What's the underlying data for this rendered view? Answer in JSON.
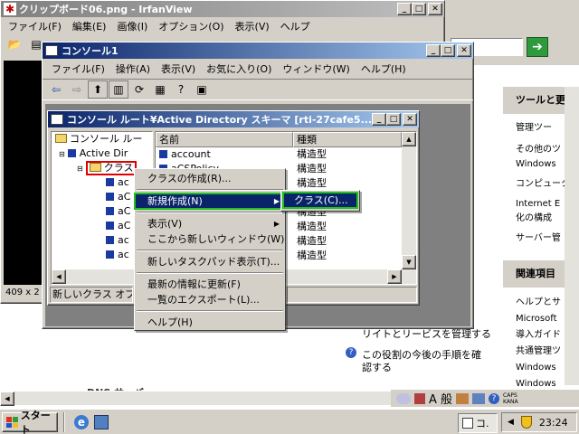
{
  "irfan": {
    "title": "クリップボード06.png - IrfanView",
    "menu": [
      "ファイル(F)",
      "編集(E)",
      "画像(I)",
      "オプション(O)",
      "表示(V)",
      "ヘルプ"
    ],
    "status": "409 x 2"
  },
  "console": {
    "title": "コンソール1",
    "menu": [
      "ファイル(F)",
      "操作(A)",
      "表示(V)",
      "お気に入り(O)",
      "ウィンドウ(W)",
      "ヘルプ(H)"
    ]
  },
  "schema": {
    "title": "コンソール ルート¥Active Directory スキーマ [rti-27cafe5...",
    "tree": {
      "root": "コンソール ルー",
      "ad": "Active Dir",
      "classes": "クラス",
      "items": [
        "ac",
        "aC",
        "aC",
        "aC",
        "ac",
        "ac"
      ]
    },
    "columns": {
      "name": "名前",
      "type": "種類"
    },
    "rows": [
      {
        "name": "account",
        "type": "構造型"
      },
      {
        "name": "aCSPolicy",
        "type": "構造型"
      },
      {
        "name": "",
        "type": "構造型"
      },
      {
        "name": "",
        "type": "構造型"
      },
      {
        "name": "",
        "type": "構造型"
      },
      {
        "name": "",
        "type": "構造型"
      },
      {
        "name": "",
        "type": "構造型"
      },
      {
        "name": "",
        "type": "構造型"
      }
    ],
    "status": "新しいクラス オブ"
  },
  "context_menu": {
    "items": [
      "クラスの作成(R)...",
      "新規作成(N)",
      "表示(V)",
      "ここから新しいウィンドウ(W)",
      "新しいタスクパッド表示(T)...",
      "最新の情報に更新(F)",
      "一覧のエクスポート(L)...",
      "ヘルプ(H)"
    ]
  },
  "submenu": {
    "item": "クラス(C)..."
  },
  "right_panel": {
    "tools_header": "ツールと更",
    "tools": [
      "管理ツー",
      "その他のツ",
      "Windows",
      "コンピュータ",
      "Internet E",
      "化の構成",
      "サーバー管"
    ],
    "related_header": "関連項目",
    "related": [
      "ヘルプとサ",
      "Microsoft",
      "導入ガイド",
      "共通管理ツ",
      "Windows",
      "Windows"
    ]
  },
  "bg": {
    "line1": "リイトとリービスを管理する",
    "line2": "この役割の今後の手順を確",
    "line3": "認する",
    "dns": "DNS サーバー"
  },
  "taskbar": {
    "start": "スタート",
    "task": "コ.",
    "clock": "23:24",
    "ime": "A 般",
    "caps": "CAPS",
    "kana": "KANA"
  }
}
